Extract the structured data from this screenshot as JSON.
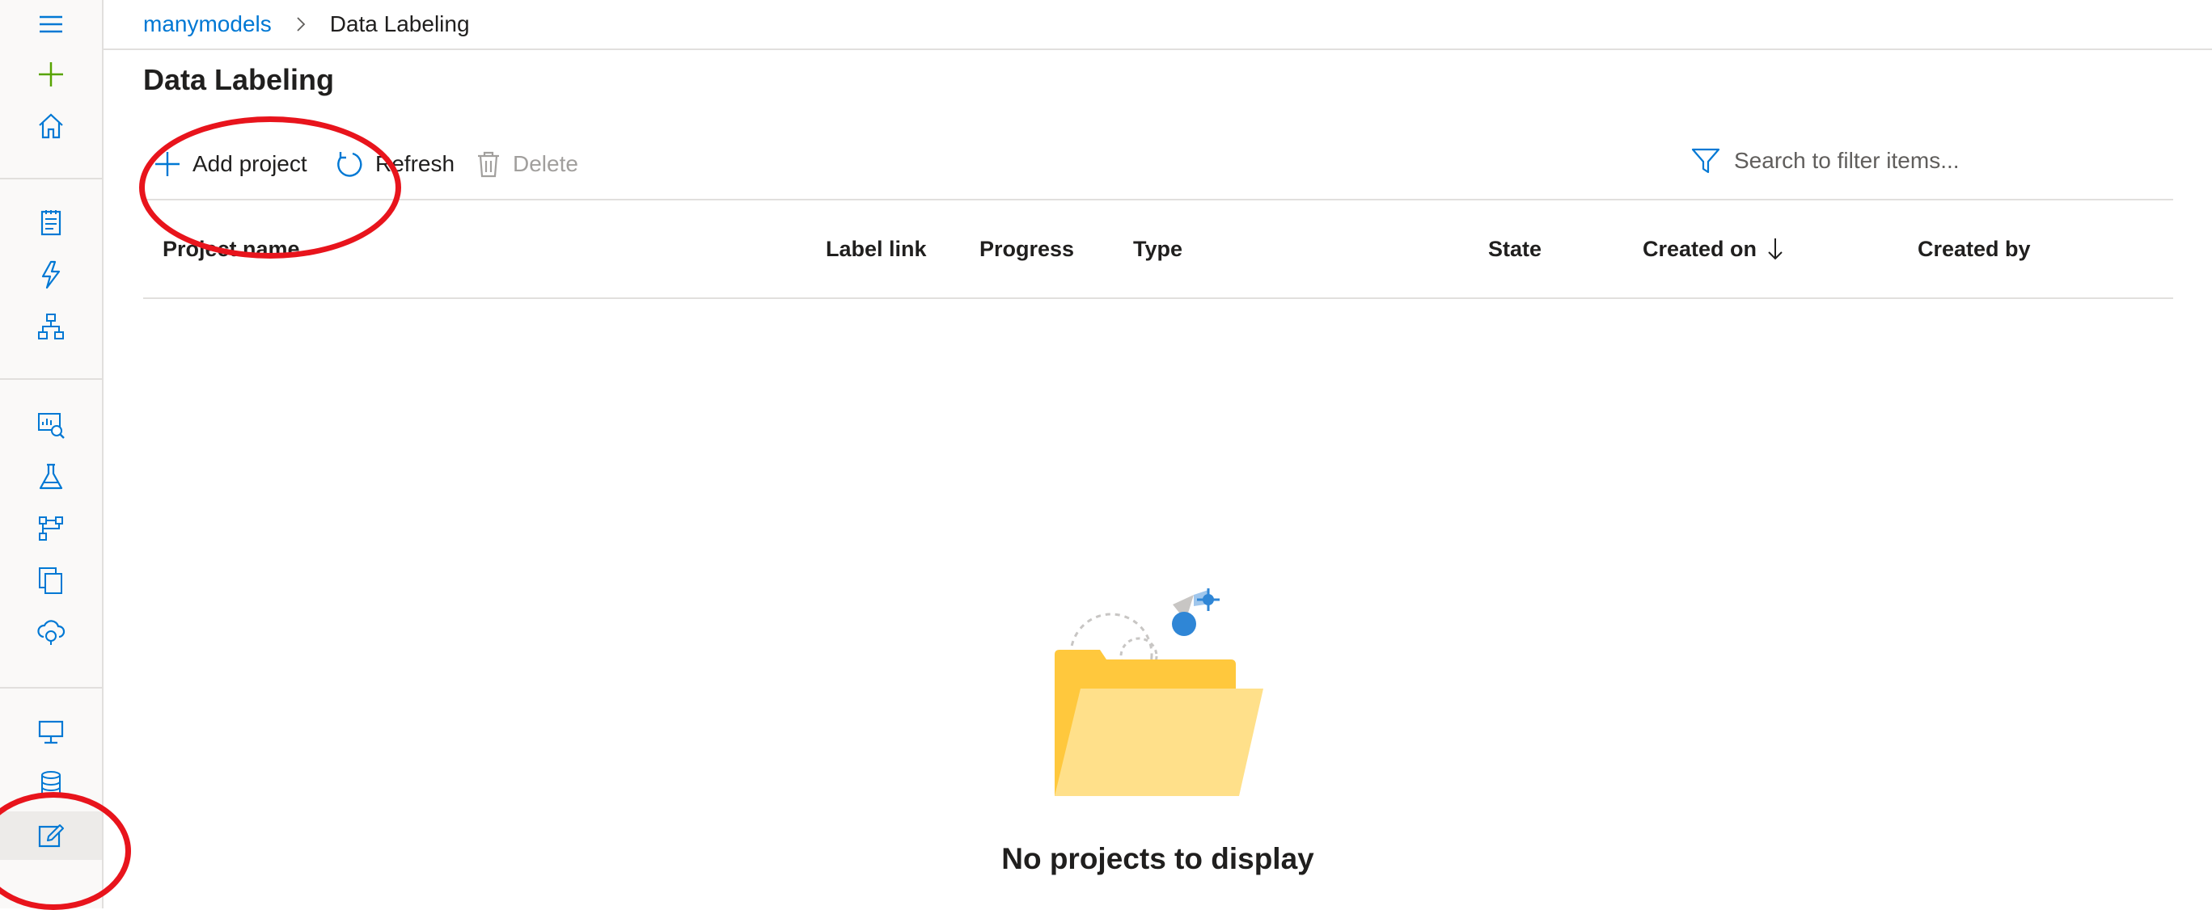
{
  "breadcrumb": {
    "workspace": "manymodels",
    "current": "Data Labeling"
  },
  "page": {
    "title": "Data Labeling"
  },
  "toolbar": {
    "add_label": "Add project",
    "refresh_label": "Refresh",
    "delete_label": "Delete"
  },
  "search": {
    "placeholder": "Search to filter items..."
  },
  "table": {
    "columns": {
      "project_name": "Project name",
      "label_link": "Label link",
      "progress": "Progress",
      "type": "Type",
      "state": "State",
      "created_on": "Created on",
      "created_by": "Created by"
    }
  },
  "empty": {
    "message": "No projects to display"
  },
  "sidebar": {
    "icons": [
      "hamburger-icon",
      "plus-icon",
      "home-icon",
      "notebook-icon",
      "automl-icon",
      "designer-icon",
      "datasets-icon",
      "experiments-icon",
      "pipelines-icon",
      "models-icon",
      "endpoints-icon",
      "compute-icon",
      "datastores-icon",
      "data-labeling-icon"
    ]
  },
  "colors": {
    "accent": "#0078d4",
    "new_green": "#57a300",
    "annotation_red": "#e8141c",
    "folder_back": "#ffc83d",
    "folder_front": "#ffe08a"
  }
}
